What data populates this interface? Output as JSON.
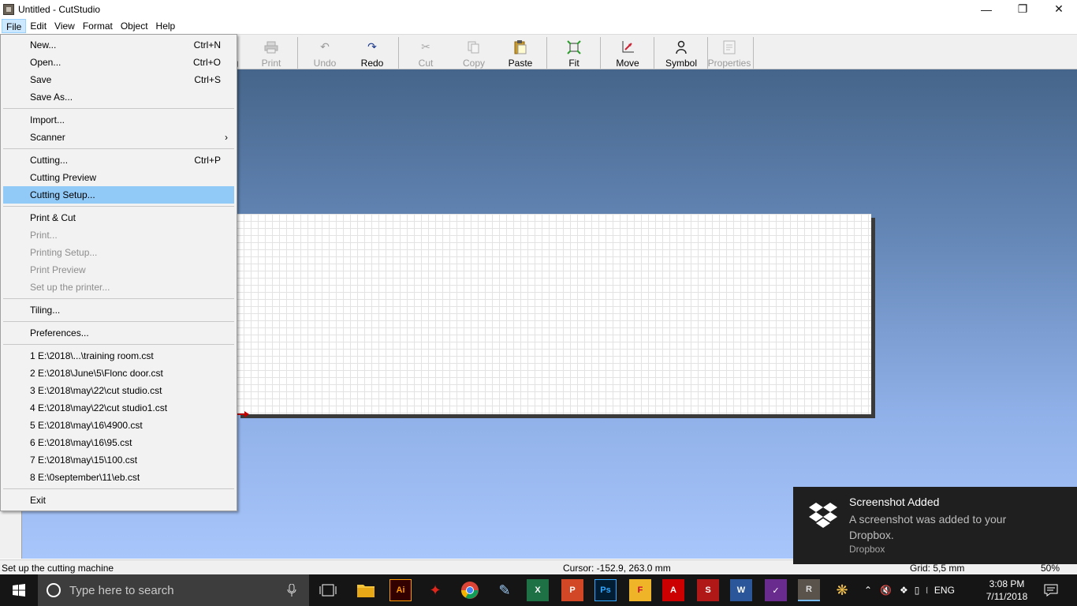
{
  "window": {
    "title": "Untitled - CutStudio"
  },
  "menubar": {
    "items": [
      "File",
      "Edit",
      "View",
      "Format",
      "Object",
      "Help"
    ]
  },
  "toolbar": {
    "buttons": [
      {
        "label": "g",
        "icon": "partial-icon",
        "enabled": true
      },
      {
        "label": "Print",
        "icon": "printer-icon",
        "enabled": false
      },
      {
        "label": "Undo",
        "icon": "undo-icon",
        "enabled": false
      },
      {
        "label": "Redo",
        "icon": "redo-icon",
        "enabled": true
      },
      {
        "label": "Cut",
        "icon": "scissors-icon",
        "enabled": false
      },
      {
        "label": "Copy",
        "icon": "copy-icon",
        "enabled": false
      },
      {
        "label": "Paste",
        "icon": "clipboard-icon",
        "enabled": true
      },
      {
        "label": "Fit",
        "icon": "fit-icon",
        "enabled": true
      },
      {
        "label": "Move",
        "icon": "move-icon",
        "enabled": true
      },
      {
        "label": "Symbol",
        "icon": "person-icon",
        "enabled": true
      },
      {
        "label": "Properties",
        "icon": "properties-icon",
        "enabled": false
      }
    ]
  },
  "file_menu": {
    "groups": [
      [
        {
          "label": "New...",
          "shortcut": "Ctrl+N"
        },
        {
          "label": "Open...",
          "shortcut": "Ctrl+O"
        },
        {
          "label": "Save",
          "shortcut": "Ctrl+S"
        },
        {
          "label": "Save As...",
          "shortcut": ""
        }
      ],
      [
        {
          "label": "Import...",
          "shortcut": ""
        },
        {
          "label": "Scanner",
          "shortcut": "",
          "submenu": true
        }
      ],
      [
        {
          "label": "Cutting...",
          "shortcut": "Ctrl+P"
        },
        {
          "label": "Cutting Preview",
          "shortcut": ""
        },
        {
          "label": "Cutting Setup...",
          "shortcut": "",
          "highlighted": true
        }
      ],
      [
        {
          "label": "Print & Cut",
          "shortcut": ""
        },
        {
          "label": "Print...",
          "shortcut": "",
          "disabled": true
        },
        {
          "label": "Printing Setup...",
          "shortcut": "",
          "disabled": true
        },
        {
          "label": "Print Preview",
          "shortcut": "",
          "disabled": true
        },
        {
          "label": "Set up the printer...",
          "shortcut": "",
          "disabled": true
        }
      ],
      [
        {
          "label": "Tiling...",
          "shortcut": ""
        }
      ],
      [
        {
          "label": "Preferences...",
          "shortcut": ""
        }
      ],
      [
        {
          "label": "1 E:\\2018\\...\\training room.cst",
          "shortcut": ""
        },
        {
          "label": "2 E:\\2018\\June\\5\\Flonc door.cst",
          "shortcut": ""
        },
        {
          "label": "3 E:\\2018\\may\\22\\cut studio.cst",
          "shortcut": ""
        },
        {
          "label": "4 E:\\2018\\may\\22\\cut studio1.cst",
          "shortcut": ""
        },
        {
          "label": "5 E:\\2018\\may\\16\\4900.cst",
          "shortcut": ""
        },
        {
          "label": "6 E:\\2018\\may\\16\\95.cst",
          "shortcut": ""
        },
        {
          "label": "7 E:\\2018\\may\\15\\100.cst",
          "shortcut": ""
        },
        {
          "label": "8 E:\\0september\\11\\eb.cst",
          "shortcut": ""
        }
      ],
      [
        {
          "label": "Exit",
          "shortcut": ""
        }
      ]
    ]
  },
  "statusbar": {
    "message": "Set up the cutting machine",
    "cursor": "Cursor: -152.9, 263.0 mm",
    "grid": "Grid: 5,5 mm",
    "zoom": "50%"
  },
  "toast": {
    "title": "Screenshot Added",
    "body": "A screenshot was added to your Dropbox.",
    "source": "Dropbox"
  },
  "taskbar": {
    "search_placeholder": "Type here to search",
    "language": "ENG",
    "time": "3:08 PM",
    "date": "7/11/2018"
  },
  "colors": {
    "menu_highlight": "#91c9f7",
    "canvas_top": "#46658a",
    "canvas_bottom": "#a9c6fb",
    "taskbar": "#151515",
    "toast_bg": "#1f1f1f"
  }
}
